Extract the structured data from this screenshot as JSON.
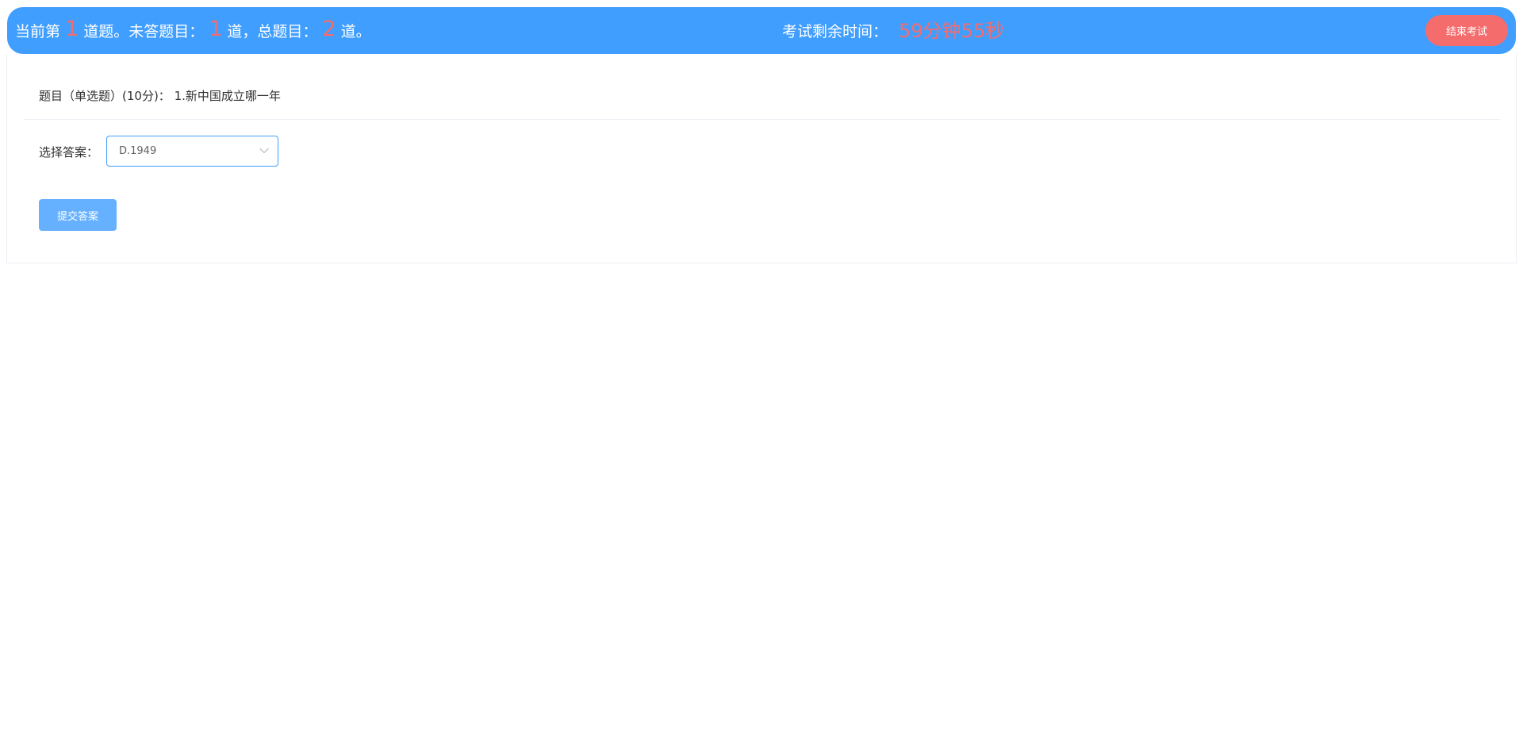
{
  "status_bar": {
    "prefix": "当前第",
    "current_number": "1",
    "after_current": "道题。未答题目：",
    "unanswered_number": "1",
    "after_unanswered": "道，总题目：",
    "total_number": "2",
    "suffix": "道。"
  },
  "timer": {
    "label": "考试剩余时间：",
    "value": "59分钟55秒"
  },
  "end_exam_button": {
    "label": "结束考试"
  },
  "question": {
    "prefix": "题目（单选题）(10分)：",
    "text": "1.新中国成立哪一年"
  },
  "answer": {
    "label": "选择答案：",
    "selected_value": "D.1949"
  },
  "submit_button": {
    "label": "提交答案"
  },
  "colors": {
    "header_bg": "#409eff",
    "accent_red": "#f56c6c",
    "submit_bg": "#66b1ff",
    "select_border": "#409eff"
  },
  "icons": {
    "select_arrow": "chevron-down-icon"
  }
}
